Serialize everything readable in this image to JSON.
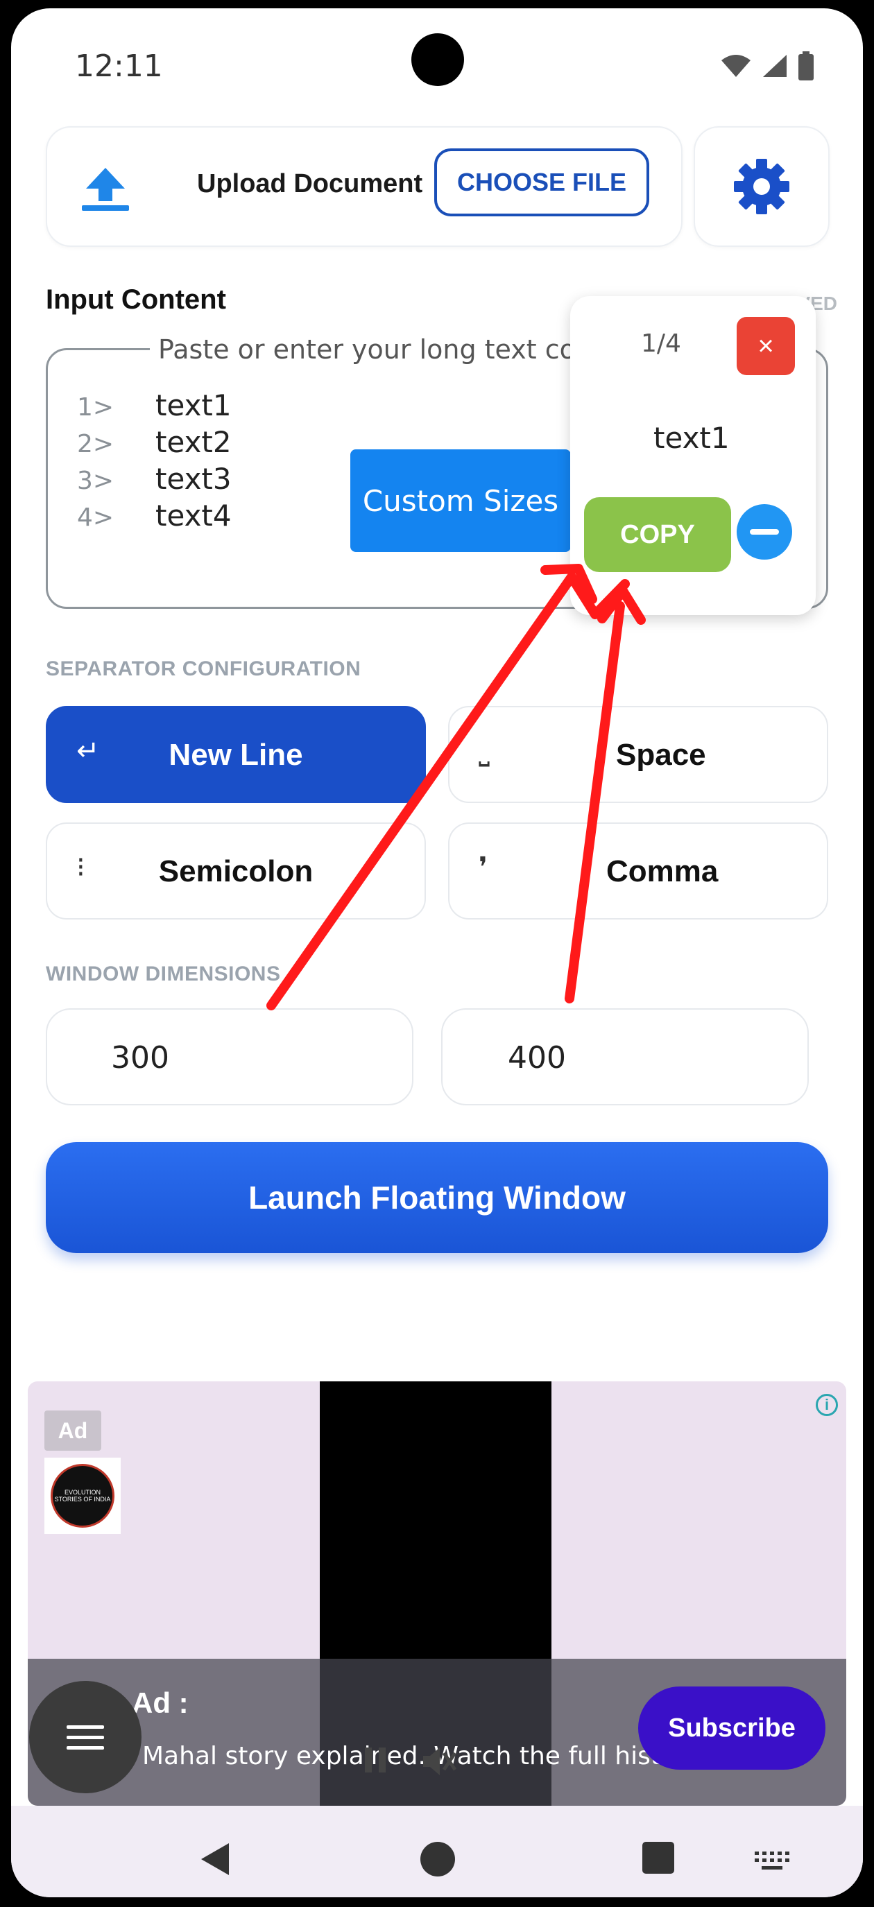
{
  "status_bar": {
    "time": "12:11"
  },
  "upload": {
    "title": "Upload Document",
    "choose_label": "CHOOSE FILE"
  },
  "input": {
    "label": "Input Content",
    "placeholder": "Paste or enter your long text co",
    "saved_hint": "AUTO SAVED",
    "lines": [
      {
        "num": "1>",
        "text": "text1"
      },
      {
        "num": "2>",
        "text": "text2"
      },
      {
        "num": "3>",
        "text": "text3"
      },
      {
        "num": "4>",
        "text": "text4"
      }
    ]
  },
  "custom_sizes_label": "Custom Sizes",
  "floating_window": {
    "counter": "1/4",
    "close_symbol": "×",
    "current_text": "text1",
    "copy_label": "COPY"
  },
  "separator": {
    "label": "SEPARATOR CONFIGURATION",
    "options": [
      {
        "symbol": "↵",
        "label": "New Line",
        "active": true
      },
      {
        "symbol": "⎵",
        "label": "Space",
        "active": false
      },
      {
        "symbol": "⁝",
        "label": "Semicolon",
        "active": false
      },
      {
        "symbol": "❜",
        "label": "Comma",
        "active": false
      }
    ]
  },
  "dimensions": {
    "label": "WINDOW DIMENSIONS",
    "width": "300",
    "height": "400"
  },
  "launch_label": "Launch Floating Window",
  "ad": {
    "badge": "Ad",
    "title": "Ad :",
    "description": "Mahal story explained. Watch the full hist...",
    "subscribe_label": "Subscribe",
    "logo_text": "EVOLUTION STORIES OF INDIA"
  },
  "colors": {
    "primary": "#1a4fc8",
    "copy_green": "#8bc34a",
    "close_red": "#ea4335",
    "arrow_red": "#ff1a1a"
  }
}
